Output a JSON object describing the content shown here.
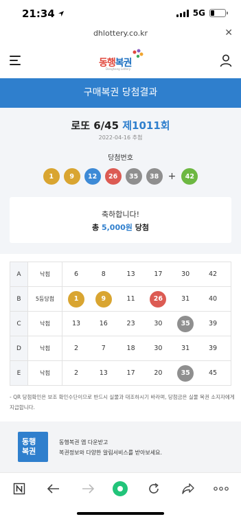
{
  "status": {
    "time": "21:34",
    "network": "5G"
  },
  "browser": {
    "url": "dhlottery.co.kr"
  },
  "header": {
    "logo_text_1": "동행",
    "logo_text_2": "복권",
    "logo_sub": "Donghang Lottery"
  },
  "page": {
    "band_title": "구매복권 당첨결과"
  },
  "round": {
    "game": "로또 6/45",
    "number": "제1011회",
    "date": "2022-04-16 추첨"
  },
  "winning": {
    "label": "당첨번호",
    "numbers": [
      {
        "value": "1",
        "color": "#d9a531"
      },
      {
        "value": "9",
        "color": "#d9a531"
      },
      {
        "value": "12",
        "color": "#3d8ad6"
      },
      {
        "value": "26",
        "color": "#dc5b53"
      },
      {
        "value": "35",
        "color": "#8f8f8f"
      },
      {
        "value": "38",
        "color": "#8f8f8f"
      }
    ],
    "plus": "+",
    "bonus": {
      "value": "42",
      "color": "#6db842"
    }
  },
  "congrats": {
    "line1": "축하합니다!",
    "prefix": "총",
    "amount": "5,000원",
    "suffix": "당첨"
  },
  "tickets": [
    {
      "label": "A",
      "result": "낙첨",
      "numbers": [
        {
          "v": "6",
          "hit": false
        },
        {
          "v": "8",
          "hit": false
        },
        {
          "v": "13",
          "hit": false
        },
        {
          "v": "17",
          "hit": false
        },
        {
          "v": "30",
          "hit": false
        },
        {
          "v": "42",
          "hit": false
        }
      ]
    },
    {
      "label": "B",
      "result": "5등당첨",
      "numbers": [
        {
          "v": "1",
          "hit": true,
          "color": "#d9a531"
        },
        {
          "v": "9",
          "hit": true,
          "color": "#d9a531"
        },
        {
          "v": "11",
          "hit": false
        },
        {
          "v": "26",
          "hit": true,
          "color": "#dc5b53"
        },
        {
          "v": "31",
          "hit": false
        },
        {
          "v": "40",
          "hit": false
        }
      ]
    },
    {
      "label": "C",
      "result": "낙첨",
      "numbers": [
        {
          "v": "13",
          "hit": false
        },
        {
          "v": "16",
          "hit": false
        },
        {
          "v": "23",
          "hit": false
        },
        {
          "v": "30",
          "hit": false
        },
        {
          "v": "35",
          "hit": true,
          "color": "#8f8f8f"
        },
        {
          "v": "39",
          "hit": false
        }
      ]
    },
    {
      "label": "D",
      "result": "낙첨",
      "numbers": [
        {
          "v": "2",
          "hit": false
        },
        {
          "v": "7",
          "hit": false
        },
        {
          "v": "18",
          "hit": false
        },
        {
          "v": "30",
          "hit": false
        },
        {
          "v": "31",
          "hit": false
        },
        {
          "v": "39",
          "hit": false
        }
      ]
    },
    {
      "label": "E",
      "result": "낙첨",
      "numbers": [
        {
          "v": "2",
          "hit": false
        },
        {
          "v": "13",
          "hit": false
        },
        {
          "v": "17",
          "hit": false
        },
        {
          "v": "20",
          "hit": false
        },
        {
          "v": "35",
          "hit": true,
          "color": "#8f8f8f"
        },
        {
          "v": "45",
          "hit": false
        }
      ]
    }
  ],
  "note": "- QR 당첨확인은 보조 확인수단이므로 반드시 실물과 대조하시기 바라며, 당첨금은 실물 복권 소지자에게 지급합니다.",
  "app_banner": {
    "logo_line1": "동행",
    "logo_line2": "복권",
    "line1": "동행복권 앱 다운받고",
    "line2": "복권정보와 다양한 알림서비스를 받아보세요."
  },
  "toolbar": {
    "icons": [
      "naver-icon",
      "back-icon",
      "forward-icon",
      "home-green-icon",
      "reload-icon",
      "share-icon",
      "more-icon"
    ]
  }
}
